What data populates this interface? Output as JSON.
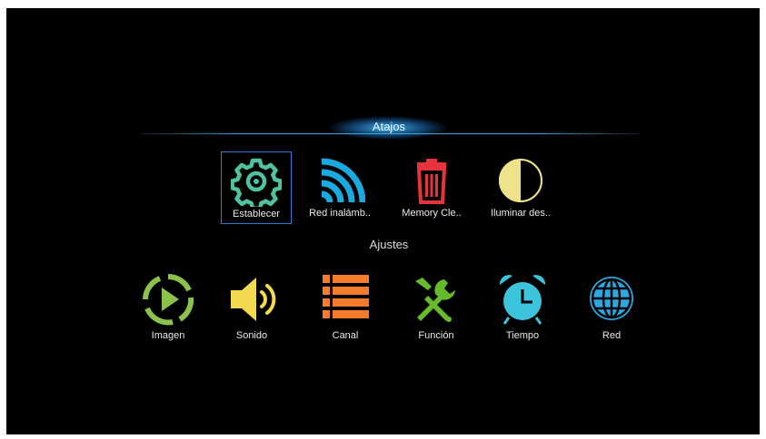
{
  "shortcuts": {
    "title": "Atajos",
    "items": [
      {
        "label": "Establecer",
        "icon": "gear-icon"
      },
      {
        "label": "Red inalámb..",
        "icon": "wifi-icon"
      },
      {
        "label": "Memory Cle..",
        "icon": "trash-icon"
      },
      {
        "label": "Iluminar des..",
        "icon": "half-moon-icon"
      }
    ],
    "focused_index": 0
  },
  "settings": {
    "title": "Ajustes",
    "items": [
      {
        "label": "Imagen",
        "icon": "play-circle-icon"
      },
      {
        "label": "Sonido",
        "icon": "speaker-icon"
      },
      {
        "label": "Canal",
        "icon": "list-icon"
      },
      {
        "label": "Función",
        "icon": "tools-icon"
      },
      {
        "label": "Tiempo",
        "icon": "alarm-clock-icon"
      },
      {
        "label": "Red",
        "icon": "globe-icon"
      }
    ]
  },
  "colors": {
    "background": "#000000",
    "focus_border": "#2f7fd8",
    "accent_line": "#3aa7d8",
    "gear": "#4fc3a0",
    "wifi": "#1aa9e0",
    "trash": "#e8323c",
    "moon": "#eee38a",
    "imagen": "#8bc34a",
    "sonido": "#f2d94e",
    "canal": "#f57c2a",
    "funcion": "#66bb2a",
    "tiempo": "#3cc4dc",
    "red": "#2aa9e0"
  }
}
